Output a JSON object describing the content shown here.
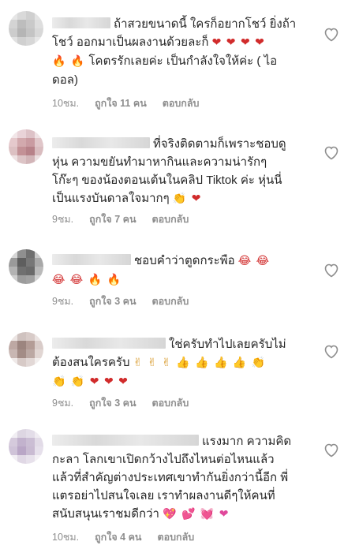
{
  "comments": [
    {
      "text_lines": [
        "ถ้าสวยขนาดนี้ ใครก็อยากโชว์ ยิ่งถ้า",
        "โชว์ ออกมาเป็นผลงานด้วยละก็",
        "โคตรรักเลยค่ะ เป็นกำลังใจให้ค่ะ ( ไอ",
        "ดอล)"
      ],
      "emojis_line2": "❤ ❤ ❤ ❤",
      "emojis_line3": "🔥 🔥",
      "time": "10ชม.",
      "likes": "ถูกใจ 11 คน",
      "reply": "ตอบกลับ"
    },
    {
      "text_lines": [
        "ที่จริงติดตามก็เพราะชอบดู",
        "หุ่น ความขยันทำมาหากินและความน่ารักๆ",
        "โก๊ะๆ ของน้องตอนเต้นในคลิป Tiktok ค่ะ หุ่นนี่",
        "เป็นแรงบันดาลใจมากๆ"
      ],
      "emojis_line4": "👏 ❤",
      "time": "9ชม.",
      "likes": "ถูกใจ 7 คน",
      "reply": "ตอบกลับ"
    },
    {
      "text_lines": [
        "ชอบคำว่าตูดกระพือ"
      ],
      "emojis_line1": "😂 😂",
      "emojis_line2": "😂 😂 🔥 🔥",
      "time": "9ชม.",
      "likes": "ถูกใจ 3 คน",
      "reply": "ตอบกลับ"
    },
    {
      "text_lines": [
        "ใช่ครับทำไปเลยครับไม่",
        "ต้องสนใครครับ"
      ],
      "emojis_line2": "✌ ✌ ✌ 👍 👍 👍 👍 👏",
      "emojis_line3": "👏 👏 ❤ ❤ ❤",
      "time": "9ชม.",
      "likes": "ถูกใจ 3 คน",
      "reply": "ตอบกลับ"
    },
    {
      "text_lines": [
        "แรงมาก ความคิด",
        "กะลา โลกเขาเปิดกว้างไปถึงไหนต่อไหนแล้ว",
        "แล้วที่สำคัญต่างประเทศเขาทำกันยิ่งกว่านี้อีก พี่",
        "แตรอย่าไปสนใจเลย เราทำผลงานดีๆให้คนที่",
        "สนับสนุนเราชมดีกว่า"
      ],
      "emojis_line5": "💖 💕 💓 ❤",
      "time": "10ชม.",
      "likes": "ถูกใจ 4 คน",
      "reply": "ตอบกลับ"
    }
  ],
  "icons": {
    "like": "heart-outline-icon"
  }
}
